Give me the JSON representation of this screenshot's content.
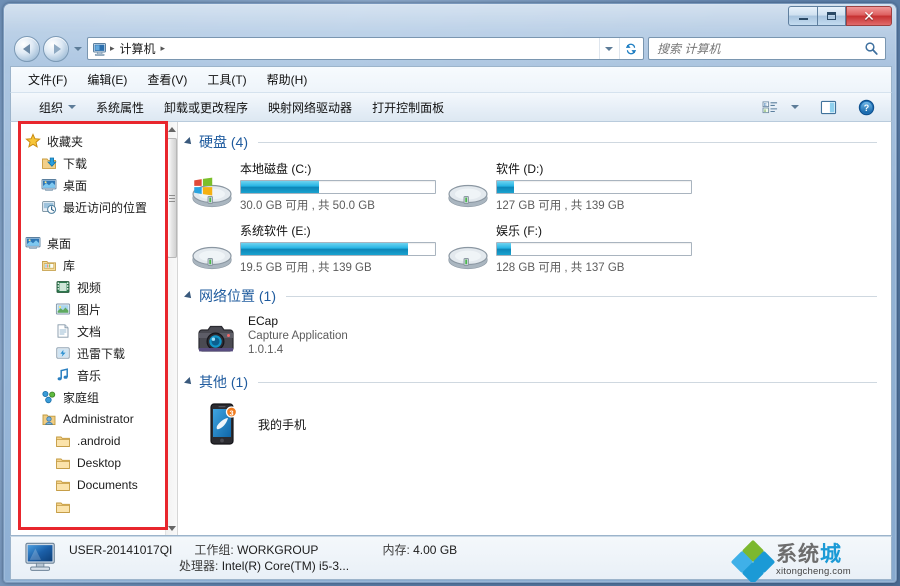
{
  "window": {
    "controls": {
      "minimize_label": "Minimize",
      "maximize_label": "Maximize",
      "close_label": "✕"
    }
  },
  "address_bar": {
    "computer_icon": "computer-icon",
    "crumbs": [
      "计算机"
    ],
    "sep": "▸",
    "dropdown_icon": "chevron-down-icon",
    "refresh_icon": "refresh-icon",
    "refresh_glyph": "↻"
  },
  "search": {
    "placeholder": "搜索 计算机",
    "value": "",
    "icon": "search-icon"
  },
  "menu": {
    "items": [
      {
        "label": "文件(F)",
        "name": "menu-file"
      },
      {
        "label": "编辑(E)",
        "name": "menu-edit"
      },
      {
        "label": "查看(V)",
        "name": "menu-view"
      },
      {
        "label": "工具(T)",
        "name": "menu-tools"
      },
      {
        "label": "帮助(H)",
        "name": "menu-help"
      }
    ]
  },
  "toolbar": {
    "organize_label": "组织",
    "items": [
      {
        "label": "系统属性",
        "name": "toolbar-system-properties"
      },
      {
        "label": "卸载或更改程序",
        "name": "toolbar-uninstall-change-program"
      },
      {
        "label": "映射网络驱动器",
        "name": "toolbar-map-network-drive"
      },
      {
        "label": "打开控制面板",
        "name": "toolbar-open-control-panel"
      }
    ],
    "view_icon": "view-options-icon",
    "view_caret_icon": "chevron-down-icon",
    "preview_icon": "preview-pane-icon",
    "help_icon": "help-icon",
    "help_glyph": "?"
  },
  "sidebar": {
    "items": [
      {
        "label": "收藏夹",
        "icon": "star-icon",
        "level": 0,
        "name": "sidebar-item-favorites"
      },
      {
        "label": "下载",
        "icon": "downloads-icon",
        "level": 1,
        "name": "sidebar-item-downloads"
      },
      {
        "label": "桌面",
        "icon": "desktop-icon",
        "level": 1,
        "name": "sidebar-item-desktop-fav"
      },
      {
        "label": "最近访问的位置",
        "icon": "recent-places-icon",
        "level": 1,
        "name": "sidebar-item-recent-places"
      },
      {
        "label": "",
        "icon": "spacer",
        "level": 0,
        "name": "sidebar-spacer"
      },
      {
        "label": "桌面",
        "icon": "desktop-icon",
        "level": 0,
        "name": "sidebar-item-desktop"
      },
      {
        "label": "库",
        "icon": "library-icon",
        "level": 1,
        "name": "sidebar-item-libraries"
      },
      {
        "label": "视频",
        "icon": "video-icon",
        "level": 2,
        "name": "sidebar-item-videos"
      },
      {
        "label": "图片",
        "icon": "pictures-icon",
        "level": 2,
        "name": "sidebar-item-pictures"
      },
      {
        "label": "文档",
        "icon": "documents-icon",
        "level": 2,
        "name": "sidebar-item-documents-lib"
      },
      {
        "label": "迅雷下载",
        "icon": "thunder-download-icon",
        "level": 2,
        "name": "sidebar-item-thunder-download"
      },
      {
        "label": "音乐",
        "icon": "music-icon",
        "level": 2,
        "name": "sidebar-item-music"
      },
      {
        "label": "家庭组",
        "icon": "homegroup-icon",
        "level": 1,
        "name": "sidebar-item-homegroup"
      },
      {
        "label": "Administrator",
        "icon": "user-icon",
        "level": 1,
        "name": "sidebar-item-administrator"
      },
      {
        "label": ".android",
        "icon": "folder-icon",
        "level": 2,
        "name": "sidebar-item-android"
      },
      {
        "label": "Desktop",
        "icon": "folder-icon",
        "level": 2,
        "name": "sidebar-item-desktop-folder"
      },
      {
        "label": "Documents",
        "icon": "folder-icon",
        "level": 2,
        "name": "sidebar-item-documents-folder"
      }
    ],
    "scrollbar": {
      "up_icon": "scroll-up-icon",
      "down_icon": "scroll-down-icon",
      "thumb": "scroll-thumb"
    }
  },
  "content": {
    "groups": [
      {
        "name": "group-hard-disks",
        "title": "硬盘",
        "count": "(4)",
        "type": "drives",
        "collapse_icon": "triangle-collapse-icon",
        "drives": [
          {
            "name": "drive-c",
            "label": "本地磁盘 (C:)",
            "sub": "30.0 GB 可用 , 共 50.0 GB",
            "used_percent": 40,
            "icon": "windows-drive-icon"
          },
          {
            "name": "drive-d",
            "label": "软件 (D:)",
            "sub": "127 GB 可用 , 共 139 GB",
            "used_percent": 9,
            "icon": "drive-icon"
          },
          {
            "name": "drive-e",
            "label": "系统软件 (E:)",
            "sub": "19.5 GB 可用 , 共 139 GB",
            "used_percent": 86,
            "icon": "drive-icon"
          },
          {
            "name": "drive-f",
            "label": "娱乐 (F:)",
            "sub": "128 GB 可用 , 共 137 GB",
            "used_percent": 7,
            "icon": "drive-icon"
          }
        ]
      },
      {
        "name": "group-network-locations",
        "title": "网络位置",
        "count": "(1)",
        "type": "misc",
        "collapse_icon": "triangle-collapse-icon",
        "item": {
          "name": "item-ecap",
          "title": "ECap",
          "sub1": "Capture Application",
          "sub2": "1.0.1.4",
          "icon": "camera-icon"
        }
      },
      {
        "name": "group-other",
        "title": "其他",
        "count": "(1)",
        "type": "phone",
        "collapse_icon": "triangle-collapse-icon",
        "item": {
          "name": "item-my-phone",
          "title": "我的手机",
          "badge": "3",
          "icon": "phone-icon"
        }
      }
    ]
  },
  "status": {
    "icon": "computer-status-icon",
    "computer_name": "USER-20141017QI",
    "workgroup_label": "工作组:",
    "workgroup_value": "WORKGROUP",
    "memory_label": "内存:",
    "memory_value": "4.00 GB",
    "processor_label": "处理器:",
    "processor_value": "Intel(R) Core(TM) i5-3..."
  },
  "watermark": {
    "main_text": "系统城",
    "url": "xitongcheng.com",
    "accent_green": "#7cb82f",
    "accent_blue": "#1b9ad6",
    "accent_light": "#3fb0e8",
    "text_gray": "#6d6d6d",
    "text_blue": "#1b9ad6"
  },
  "annotation": {
    "name": "red-highlight-rectangle",
    "color": "#e8262d"
  }
}
